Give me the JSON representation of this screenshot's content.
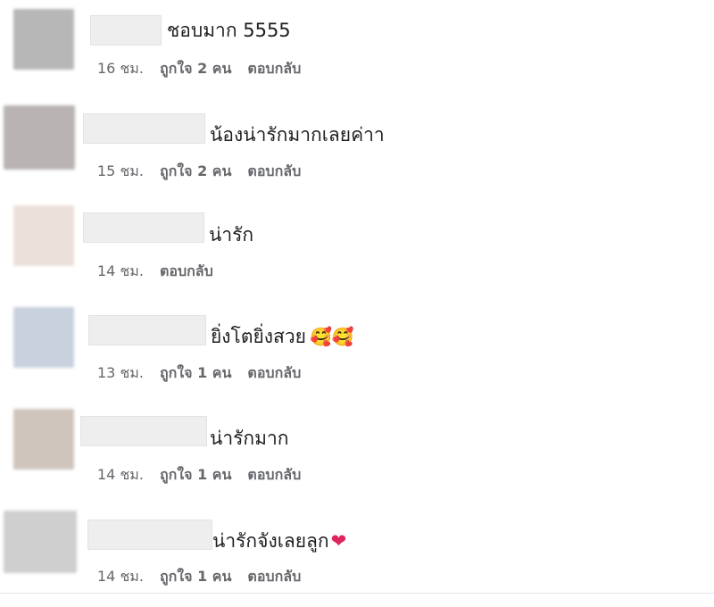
{
  "comments": [
    {
      "text": "ชอบมาก 5555",
      "time": "16 ชม.",
      "likes": "ถูกใจ 2 คน",
      "reply": "ตอบกลับ",
      "avatar_color": "#b7b7b7",
      "emoji": ""
    },
    {
      "text": "น้องน่ารักมากเลยค่าา",
      "time": "15 ชม.",
      "likes": "ถูกใจ 2 คน",
      "reply": "ตอบกลับ",
      "avatar_color": "#b9b3b3",
      "emoji": ""
    },
    {
      "text": "น่ารัก",
      "time": "14 ชม.",
      "likes": "",
      "reply": "ตอบกลับ",
      "avatar_color": "#ece0da",
      "emoji": ""
    },
    {
      "text": "ยิ่งโตยิ่งสวย",
      "time": "13 ชม.",
      "likes": "ถูกใจ 1 คน",
      "reply": "ตอบกลับ",
      "avatar_color": "#c9d1de",
      "emoji": "🥰🥰"
    },
    {
      "text": "น่ารักมาก",
      "time": "14 ชม.",
      "likes": "ถูกใจ 1 คน",
      "reply": "ตอบกลับ",
      "avatar_color": "#cfc5bd",
      "emoji": ""
    },
    {
      "text": "น่ารักจังเลยลูก",
      "time": "14 ชม.",
      "likes": "ถูกใจ 1 คน",
      "reply": "ตอบกลับ",
      "avatar_color": "#cfcfcf",
      "emoji": "❤"
    }
  ]
}
